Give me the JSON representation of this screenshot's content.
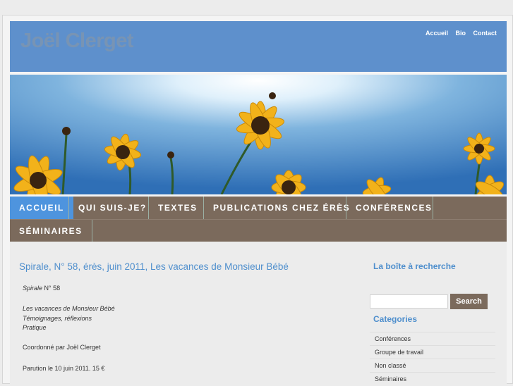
{
  "header": {
    "site_title": "Joël Clerget",
    "top_nav": [
      "Accueil",
      "Bio",
      "Contact"
    ]
  },
  "main_menu": {
    "items": [
      "ACCUEIL",
      "QUI SUIS-JE?",
      "TEXTES",
      "PUBLICATIONS CHEZ ÉRÈS",
      "CONFÉRENCES",
      "SÉMINAIRES"
    ],
    "active": "ACCUEIL"
  },
  "post": {
    "title": "Spirale, N° 58, érès, juin 2011, Les vacances de Monsieur Bébé",
    "journal_italic": "Spirale",
    "journal_rest": " N° 58",
    "subtitle_lines": [
      "Les vacances de Monsieur Bébé",
      "Témoignages, réflexions",
      "Pratique"
    ],
    "coordination": "Coordonné par Joël Clerget",
    "release": "Parution le 10 juin 2011. 15 €"
  },
  "sidebar": {
    "search_heading": "La boîte à recherche",
    "search_placeholder": "",
    "search_button": "Search",
    "categories_heading": "Categories",
    "categories": [
      "Conférences",
      "Groupe de travail",
      "Non classé",
      "Séminaires"
    ]
  },
  "colors": {
    "header_blue": "#5e90cc",
    "menu_brown": "#7b6a5c",
    "active_blue": "#4e94de",
    "link_blue": "#4f8fcd"
  }
}
